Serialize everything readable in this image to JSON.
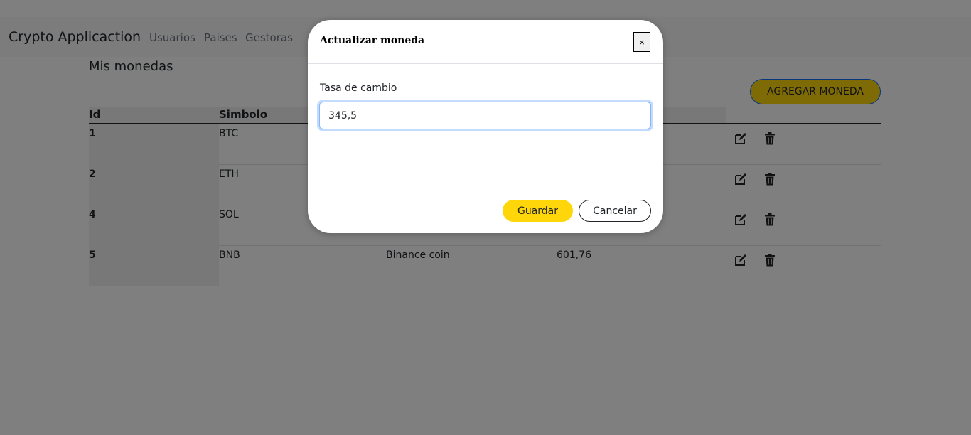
{
  "navbar": {
    "brand": "Crypto Applicaction",
    "links": [
      "Usuarios",
      "Paises",
      "Gestoras"
    ]
  },
  "main": {
    "title": "Mis monedas",
    "add_button_label": "AGREGAR MONEDA",
    "table": {
      "headers": [
        "Id",
        "Simbolo"
      ],
      "rows": [
        {
          "id": "1",
          "symbol": "BTC",
          "name": "",
          "rate": ""
        },
        {
          "id": "2",
          "symbol": "ETH",
          "name": "",
          "rate": ""
        },
        {
          "id": "4",
          "symbol": "SOL",
          "name": "",
          "rate": ""
        },
        {
          "id": "5",
          "symbol": "BNB",
          "name": "Binance coin",
          "rate": "601,76"
        }
      ]
    }
  },
  "modal": {
    "title": "Actualizar moneda",
    "close_label": "×",
    "field_label": "Tasa de cambio",
    "field_value": "345,5",
    "save_label": "Guardar",
    "cancel_label": "Cancelar"
  },
  "colors": {
    "accent_yellow": "#ffd60a",
    "focus_blue": "#86b7fe"
  },
  "icons": {
    "edit": "edit-icon",
    "delete": "trash-icon"
  }
}
